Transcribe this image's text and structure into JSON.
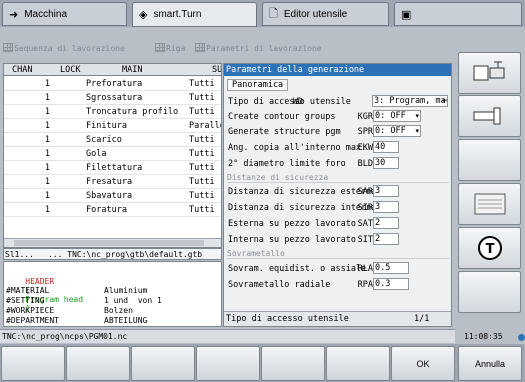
{
  "tabs": [
    {
      "label": "Macchina",
      "icon": "arrow-right-icon"
    },
    {
      "label": "smart.Turn",
      "icon": "diamond-arrows-icon"
    },
    {
      "label": "Editor utensile",
      "icon": "document-icon"
    },
    {
      "label": "",
      "icon": "save-icon"
    }
  ],
  "toolbar": {
    "seq_label": "Sequenza di lavorazione",
    "row_label": "Riga",
    "param_label": "Parametri di lavorazione"
  },
  "sequence": {
    "columns": [
      "CHAN",
      "LOCK",
      "MAIN",
      "SU"
    ],
    "rows": [
      {
        "chan": "1",
        "main": "Preforatura",
        "tutti": "Tutti"
      },
      {
        "chan": "1",
        "main": "Sgrossatura",
        "tutti": "Tutti"
      },
      {
        "chan": "1",
        "main": "Troncatura profilo",
        "tutti": "Tutti"
      },
      {
        "chan": "1",
        "main": "Finitura",
        "tutti": "Paralle"
      },
      {
        "chan": "1",
        "main": "Scarico",
        "tutti": "Tutti"
      },
      {
        "chan": "1",
        "main": "Gola",
        "tutti": "Tutti"
      },
      {
        "chan": "1",
        "main": "Filettatura",
        "tutti": "Tutti"
      },
      {
        "chan": "1",
        "main": "Fresatura",
        "tutti": "Tutti"
      },
      {
        "chan": "1",
        "main": "Sbavatura",
        "tutti": "Tutti"
      },
      {
        "chan": "1",
        "main": "Foratura",
        "tutti": "Tutti"
      }
    ],
    "path_left": "Sl1...",
    "path_right": "... TNC:\\nc_prog\\gtb\\default.gtb"
  },
  "program": {
    "header_kw": "HEADER",
    "header_open": "[",
    "header_text": "Program head",
    "header_close": "]",
    "lines": [
      {
        "k": "#MATERIAL",
        "v": "Aluminium"
      },
      {
        "k": "#SETTING",
        "v": "1 und  von 1"
      },
      {
        "k": "#WORKPIECE",
        "v": "Bolzen"
      },
      {
        "k": "#DEPARTMENT",
        "v": "ABTEILUNG"
      }
    ]
  },
  "params": {
    "title": "Parametri della generazione",
    "tab": "Panoramica",
    "rows": [
      {
        "label": "Tipo di accesso utensile",
        "key": "WD",
        "value": "3: Program, maç",
        "dd": true
      },
      {
        "label": "Create contour groups",
        "key": "KGR",
        "value": "0: OFF",
        "dd": true
      },
      {
        "label": "Generate structure pgm",
        "key": "SPR",
        "value": "0: OFF",
        "dd": true
      },
      {
        "label": "Ang. copia all'interno max.",
        "key": "EKW",
        "value": "40",
        "dd": false
      },
      {
        "label": "2° diametro limite foro",
        "key": "BLD",
        "value": "30",
        "dd": false
      }
    ],
    "group1": "Distanze di sicurezza",
    "rows2": [
      {
        "label": "Distanza di sicurezza esterna",
        "key": "SAR",
        "value": "3"
      },
      {
        "label": "Distanza di sicurezza interna",
        "key": "SIR",
        "value": "3"
      },
      {
        "label": "Esterna su pezzo lavorato",
        "key": "SAT",
        "value": "2"
      },
      {
        "label": "Interna su pezzo lavorato",
        "key": "SIT",
        "value": "2"
      }
    ],
    "group2": "Sovrametallo",
    "rows3": [
      {
        "label": "Sovram. equidist. o assiale",
        "key": "RLA",
        "value": "0.5"
      },
      {
        "label": "Sovrametallo radiale",
        "key": "RPA",
        "value": "0.3"
      }
    ],
    "status_text": "Tipo di accesso utensile",
    "page": "1/1"
  },
  "pathline": "TNC:\\nc_prog\\ncps\\PGM01.nc",
  "clock": "11:08:35",
  "softkeys": {
    "ok": "OK",
    "cancel": "Annulla"
  },
  "vsk_icons": [
    "spindle-arrow-icon",
    "tool-holder-icon",
    "",
    "tool-list-icon",
    "t-tool-icon",
    "",
    ""
  ]
}
